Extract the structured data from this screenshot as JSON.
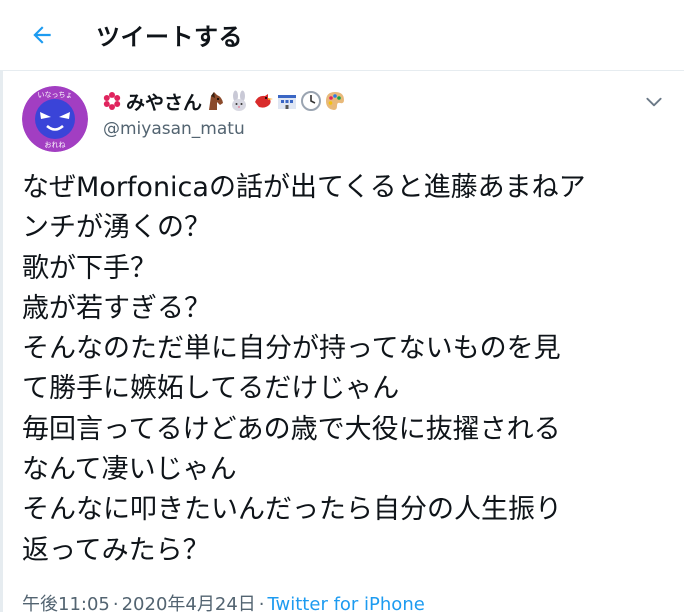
{
  "header": {
    "title": "ツイートする"
  },
  "author": {
    "display_name": "みやさん",
    "handle": "@miyasan_matu",
    "avatar_text_top": "いなっちょ",
    "avatar_text_bottom": "おれね",
    "emojis": [
      "horse-face",
      "rabbit-face",
      "red-bird",
      "station-building",
      "clock",
      "artist-palette"
    ]
  },
  "tweet": {
    "lines": [
      "なぜMorfonicaの話が出てくると進藤あまねア",
      "ンチが湧くの？",
      "歌が下手？",
      "歳が若すぎる？",
      "そんなのただ単に自分が持ってないものを見",
      "て勝手に嫉妬してるだけじゃん",
      "毎回言ってるけどあの歳で大役に抜擢される",
      "なんて凄いじゃん",
      "そんなに叩きたいんだったら自分の人生振り",
      "返ってみたら？"
    ]
  },
  "meta": {
    "time": "午後11:05",
    "separator": "·",
    "date": "2020年4月24日",
    "source": "Twitter for iPhone"
  },
  "colors": {
    "accent": "#1d9bf0",
    "text": "#0f1419",
    "secondary": "#536471",
    "divider": "#e6ecf0",
    "avatar_bg": "#a23ec2"
  }
}
